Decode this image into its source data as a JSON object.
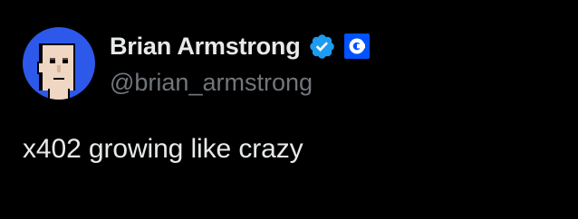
{
  "author": {
    "display_name": "Brian Armstrong",
    "handle": "@brian_armstrong",
    "verified": true,
    "verified_icon": "verified-badge-icon",
    "affiliate_icon": "coinbase-logo-icon",
    "avatar_icon": "pixel-face-avatar"
  },
  "tweet": {
    "text": "x402 growing like crazy"
  },
  "colors": {
    "background": "#000000",
    "text_primary": "#e7e9ea",
    "text_secondary": "#71767b",
    "verified_blue": "#1d9bf0",
    "avatar_bg": "#2d59ea",
    "affiliate_blue": "#0052ff"
  }
}
